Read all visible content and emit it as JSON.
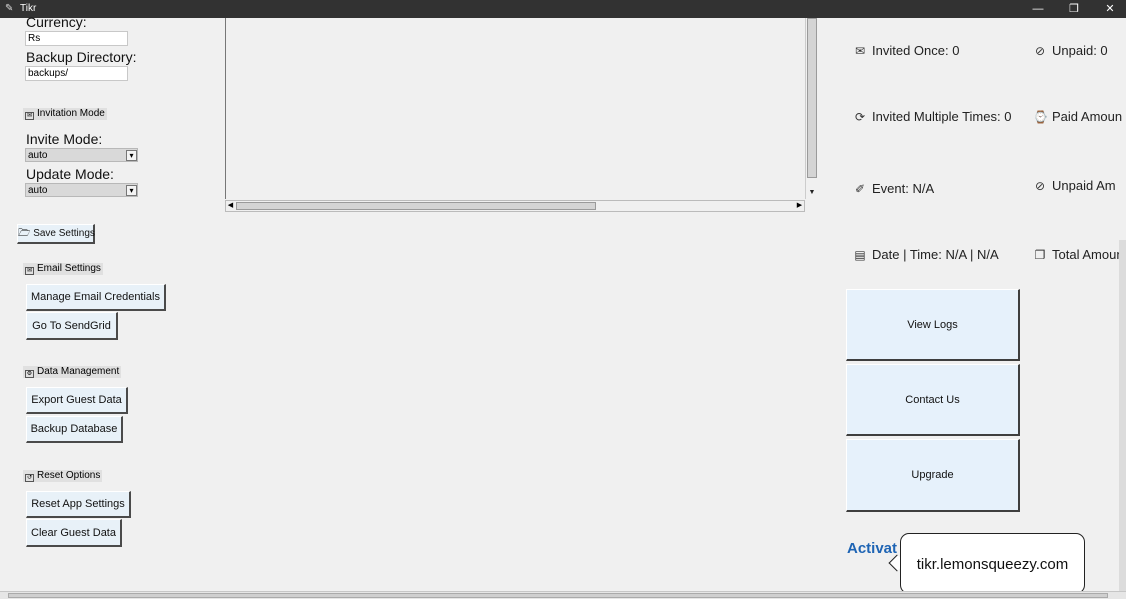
{
  "window": {
    "title": "Tikr",
    "controls": [
      "—",
      "❐",
      "✕"
    ]
  },
  "settings": {
    "currency_label": "Currency:",
    "currency_value": "Rs",
    "backup_label": "Backup Directory:",
    "backup_value": "backups/",
    "invitation_section": "Invitation Mode",
    "invite_mode_label": "Invite Mode:",
    "invite_mode_value": "auto",
    "update_mode_label": "Update Mode:",
    "update_mode_value": "auto",
    "save_button": "Save Settings",
    "email_section": "Email Settings",
    "manage_email_button": "Manage Email Credentials",
    "sendgrid_button": "Go To SendGrid",
    "data_section": "Data Management",
    "export_button": "Export Guest Data",
    "backup_button": "Backup Database",
    "reset_section": "Reset Options",
    "reset_app_button": "Reset App Settings",
    "clear_guest_button": "Clear Guest Data"
  },
  "stats": {
    "invited_once": "Invited Once: 0",
    "unpaid": "Unpaid: 0",
    "invited_multiple": "Invited Multiple Times: 0",
    "paid_amount": "Paid Amoun",
    "event": "Event: N/A",
    "unpaid_amount": "Unpaid Am",
    "date_time": "Date | Time: N/A | N/A",
    "total_amount": "Total Amoun"
  },
  "actions": {
    "view_logs": "View Logs",
    "contact_us": "Contact Us",
    "upgrade": "Upgrade",
    "activate": "Activat",
    "tooltip": "tikr.lemonsqueezy.com"
  }
}
